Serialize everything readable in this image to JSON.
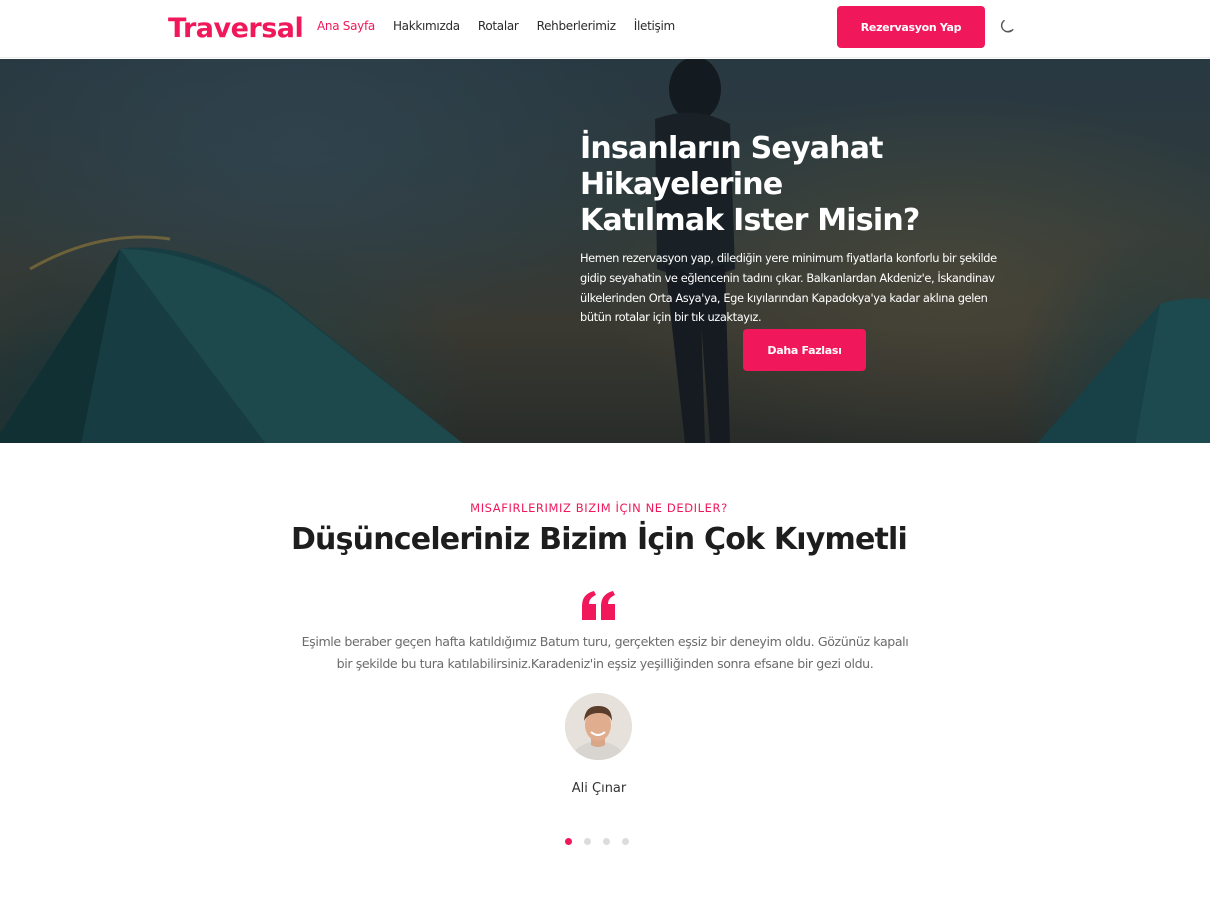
{
  "brand": {
    "name": "Traversal",
    "accent": "#f0185a"
  },
  "nav": {
    "items": [
      {
        "label": "Ana Sayfa",
        "active": true
      },
      {
        "label": "Hakkımızda",
        "active": false
      },
      {
        "label": "Rotalar",
        "active": false
      },
      {
        "label": "Rehberlerimiz",
        "active": false
      },
      {
        "label": "İletişim",
        "active": false
      }
    ],
    "cta_label": "Rezervasyon Yap",
    "theme_icon": "moon-icon"
  },
  "hero": {
    "title_line1": "İnsanların Seyahat Hikayelerine",
    "title_line2": "Katılmak Ister Misin?",
    "description": "Hemen rezervasyon yap, dilediğin yere minimum fiyatlarla konforlu bir şekilde gidip seyahatin ve eğlencenin tadını çıkar. Balkanlardan Akdeniz'e, İskandinav ülkelerinden Orta Asya'ya, Ege kıyılarından Kapadokya'ya kadar aklına gelen bütün rotalar için bir tık uzaktayız.",
    "button_label": "Daha Fazlası"
  },
  "testimonials": {
    "eyebrow": "MISAFIRLERIMIZ BIZIM İÇIN NE DEDILER?",
    "title": "Düşünceleriniz Bizim İçin Çok Kıymetli",
    "quote_icon": "quote-icon",
    "quote": "Eşimle beraber geçen hafta katıldığımız Batum turu, gerçekten eşsiz bir deneyim oldu. Gözünüz kapalı bir şekilde bu tura katılabilirsiniz.Karadeniz'in eşsiz yeşilliğinden sonra efsane bir gezi oldu.",
    "author": "Ali Çınar",
    "slides": 4,
    "active_slide": 1
  }
}
